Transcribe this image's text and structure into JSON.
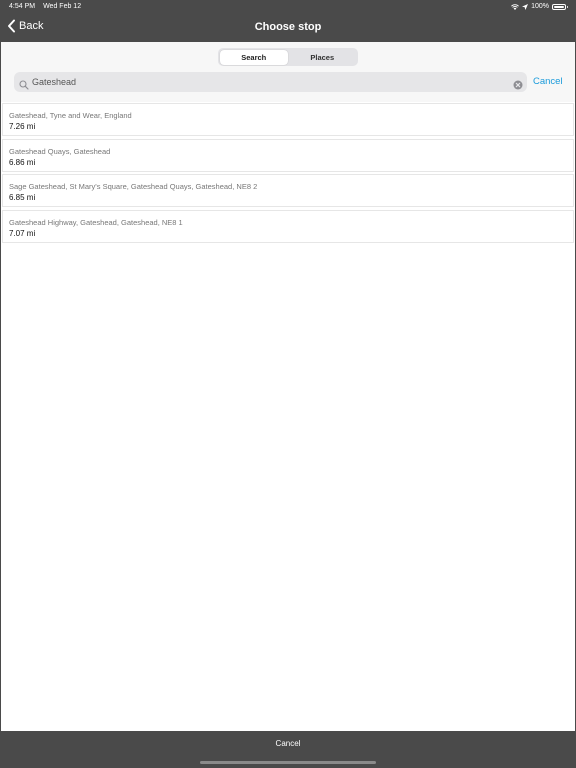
{
  "status_bar": {
    "time": "4:54 PM",
    "date": "Wed Feb 12",
    "battery": "100%",
    "battery_level": 1.0
  },
  "nav": {
    "back_label": "Back",
    "title": "Choose stop"
  },
  "segments": [
    {
      "label": "Search",
      "selected": true
    },
    {
      "label": "Places",
      "selected": false
    }
  ],
  "search": {
    "value": "Gateshead",
    "cancel_label": "Cancel"
  },
  "results": [
    {
      "name": "Gateshead, Tyne and Wear, England",
      "distance": "7.26 mi"
    },
    {
      "name": "Gateshead Quays, Gateshead",
      "distance": "6.86 mi"
    },
    {
      "name": "Sage Gateshead, St Mary's Square, Gateshead Quays, Gateshead, NE8 2",
      "distance": "6.85 mi"
    },
    {
      "name": "Gateshead Highway, Gateshead, Gateshead, NE8 1",
      "distance": "7.07 mi"
    }
  ],
  "bottom": {
    "cancel_label": "Cancel"
  },
  "colors": {
    "accent": "#1a9bdb",
    "chrome": "#4a4a4a"
  },
  "icons": [
    "wifi-icon",
    "location-icon",
    "battery-icon",
    "chevron-left-icon",
    "search-icon",
    "clear-icon"
  ]
}
